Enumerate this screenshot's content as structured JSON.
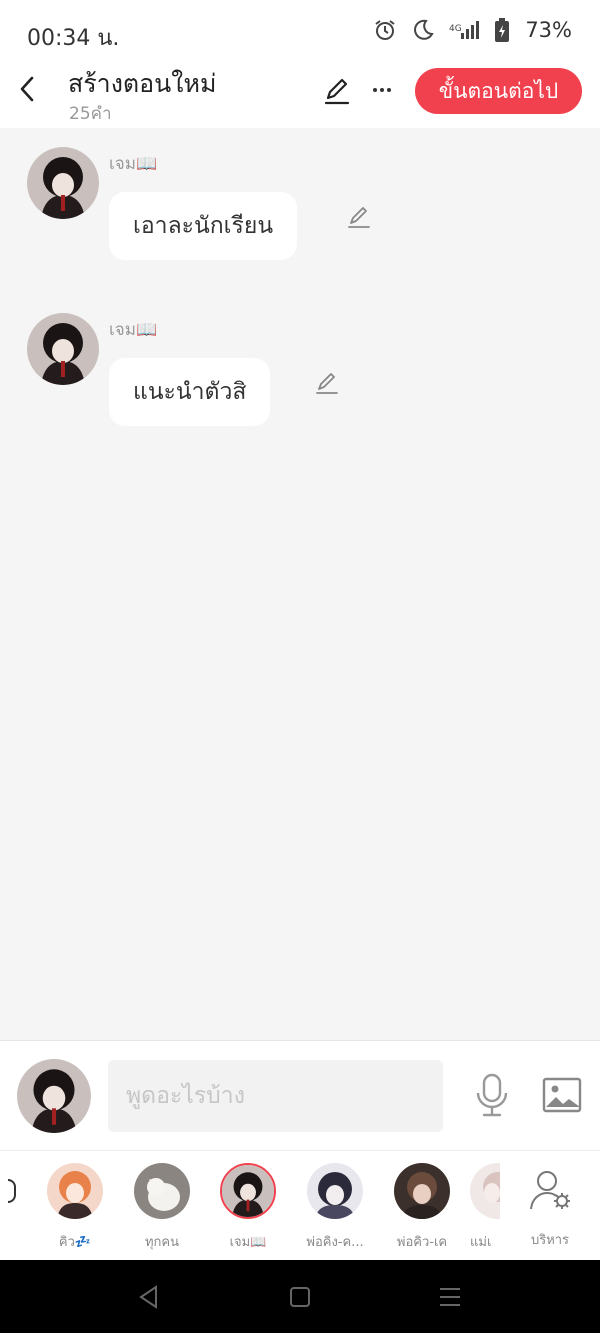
{
  "status": {
    "time": "00:34 น.",
    "battery": "73%"
  },
  "header": {
    "title": "สร้างตอนใหม่",
    "word_count": "25คำ",
    "next_label": "ขั้นตอนต่อไป"
  },
  "messages": [
    {
      "sender": "เจม📖",
      "text": "เอาละนักเรียน"
    },
    {
      "sender": "เจม📖",
      "text": "แนะนำตัวสิ"
    }
  ],
  "composer": {
    "placeholder": "พูดอะไรบ้าง"
  },
  "characters": [
    {
      "label": "คิว💤"
    },
    {
      "label": "ทุกคน"
    },
    {
      "label": "เจม📖",
      "selected": true
    },
    {
      "label": "พ่อคิง-ค..."
    },
    {
      "label": "พ่อคิว-เค"
    },
    {
      "label": "แม่เ"
    }
  ],
  "manage_label": "บริหาร",
  "colors": {
    "accent": "#f2414e",
    "background": "#f5f5f5"
  }
}
